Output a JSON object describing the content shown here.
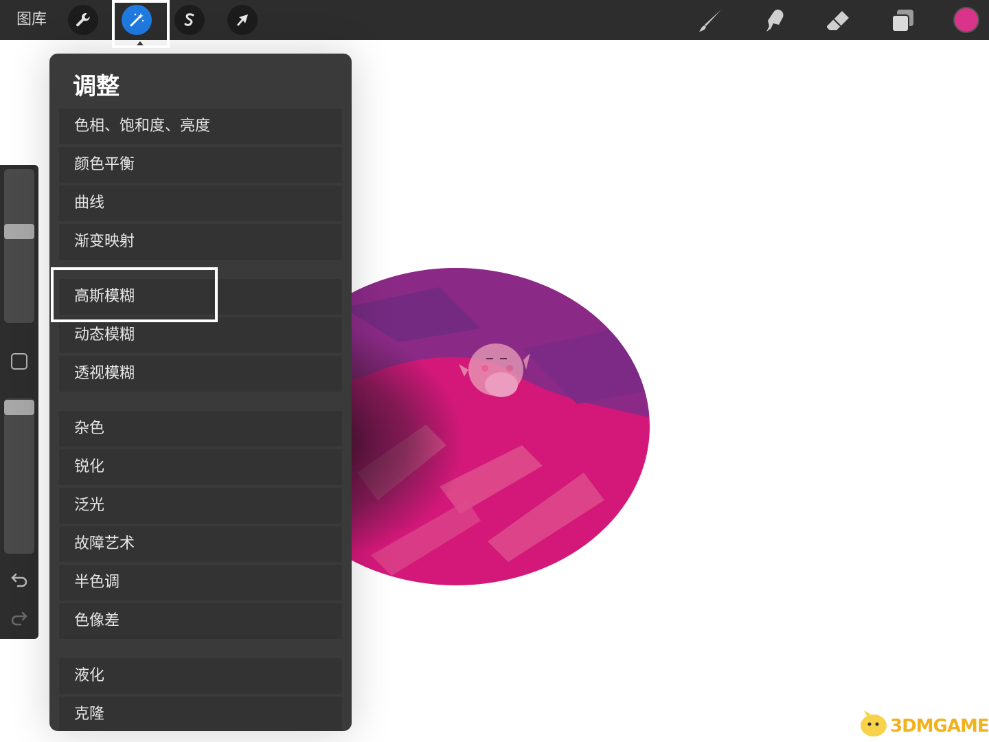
{
  "toolbar": {
    "gallery_label": "图库",
    "left_tools": [
      {
        "name": "actions",
        "icon": "wrench-icon"
      },
      {
        "name": "adjustments",
        "icon": "magic-wand-icon",
        "active": true
      },
      {
        "name": "selection",
        "icon": "selection-s-icon"
      },
      {
        "name": "transform",
        "icon": "arrow-cursor-icon"
      }
    ],
    "right_tools": [
      {
        "name": "paint",
        "icon": "brush-icon"
      },
      {
        "name": "smudge",
        "icon": "smudge-finger-icon"
      },
      {
        "name": "erase",
        "icon": "eraser-icon"
      },
      {
        "name": "layers",
        "icon": "layers-icon"
      }
    ],
    "current_color": "#d9338a"
  },
  "sidebar": {
    "brush_size_icon": "slider-track",
    "modify_icon": "square-icon",
    "undo_icon": "undo-icon",
    "redo_icon": "redo-icon"
  },
  "adjustments": {
    "title": "调整",
    "group1": [
      "色相、饱和度、亮度",
      "颜色平衡",
      "曲线",
      "渐变映射"
    ],
    "group2": [
      "高斯模糊",
      "动态模糊",
      "透视模糊"
    ],
    "group3": [
      "杂色",
      "锐化",
      "泛光",
      "故障艺术",
      "半色调",
      "色像差"
    ],
    "group4": [
      "液化",
      "克隆"
    ],
    "highlighted_item": "高斯模糊"
  },
  "colors": {
    "toolbar_bg": "#2d2d2d",
    "panel_bg": "#3a3a3a",
    "active_tool": "#1f7ae0",
    "art_magenta": "#d4187a",
    "art_purple": "#7a2a86"
  },
  "watermark": {
    "text": "3DMGAME"
  }
}
